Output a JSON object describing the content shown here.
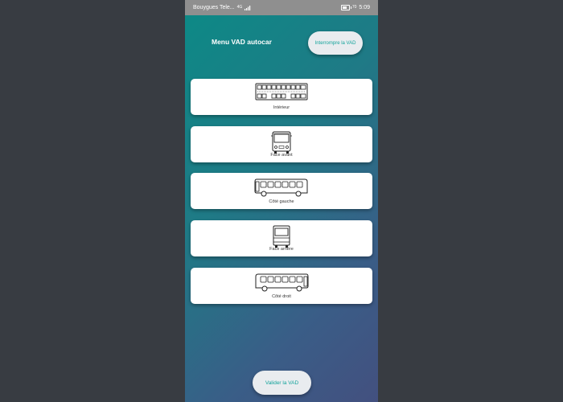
{
  "status_bar": {
    "carrier": "Bouygues Tele...",
    "network": "4G",
    "battery_percent": "70",
    "time": "5:09"
  },
  "header": {
    "title": "Menu VAD autocar",
    "stop_button": "Interrompre la VAD"
  },
  "views": [
    {
      "label": "Intérieur",
      "icon": "bus-interior-icon"
    },
    {
      "label": "Face avant",
      "icon": "bus-front-icon"
    },
    {
      "label": "Côté gauche",
      "icon": "bus-left-side-icon"
    },
    {
      "label": "Face arrière",
      "icon": "bus-rear-icon"
    },
    {
      "label": "Côté droit",
      "icon": "bus-right-side-icon"
    }
  ],
  "footer": {
    "validate_button": "Valider la VAD"
  },
  "colors": {
    "accent": "#13a39b",
    "gradient_start": "#0c8a86",
    "gradient_end": "#43507f",
    "outer_background": "#383c42"
  }
}
